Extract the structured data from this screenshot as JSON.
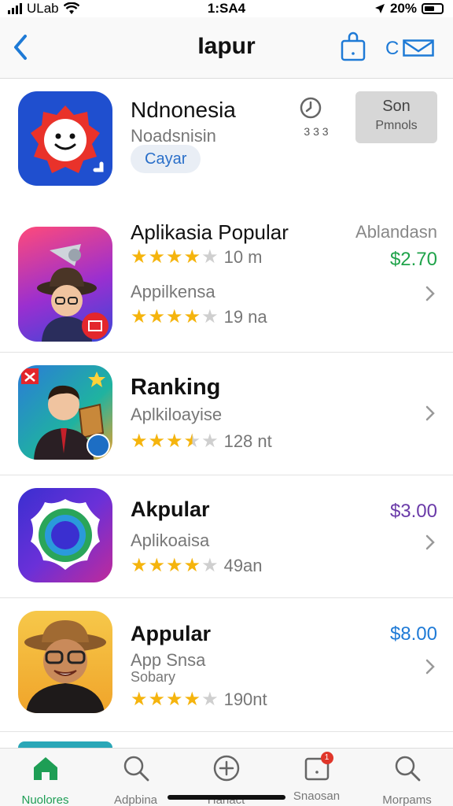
{
  "status_bar": {
    "carrier": "ULab",
    "time": "1:SA4",
    "battery": "20%"
  },
  "nav": {
    "title": "Iapur",
    "cart_label": "C"
  },
  "featured": {
    "title": "Ndnonesia",
    "subtitle": "Noadsnisin",
    "badge": "Cayar",
    "download_count": "3 3 3",
    "button_top": "Son",
    "button_bottom": "Pmnols"
  },
  "apps": [
    {
      "title": "Aplikasia Popular",
      "tag": "Ablandasn",
      "price": "$2.70",
      "price_color": "#1fa34a",
      "rating1": 4,
      "count1": "10 m",
      "subtitle": "Appilkensa",
      "rating2": 4,
      "count2": "19 na"
    },
    {
      "title": "Ranking",
      "subtitle": "Aplkiloayise",
      "rating": 3.5,
      "count": "128 nt"
    },
    {
      "title": "Akpular",
      "subtitle": "Aplikoaisa",
      "price": "$3.00",
      "price_color": "#6a3aa8",
      "rating": 4,
      "count": "49an"
    },
    {
      "title": "Appular",
      "subtitle": "App Snsa",
      "subtitle2": "Sobary",
      "price": "$8.00",
      "price_color": "#1e7ad6",
      "rating": 4,
      "count": "190nt"
    }
  ],
  "tabs": [
    {
      "label": "Nuolores",
      "icon": "home-icon",
      "active": true
    },
    {
      "label": "Adpbina",
      "icon": "search-icon",
      "active": false
    },
    {
      "label": "Hanact",
      "icon": "add-icon",
      "active": false
    },
    {
      "label": "Snaosan",
      "icon": "inbox-icon",
      "active": false,
      "badge": "1"
    },
    {
      "label": "Morpams",
      "icon": "search-icon",
      "active": false
    }
  ],
  "colors": {
    "accent": "#1e7ad6",
    "star": "#f5b40d",
    "star_empty": "#cfcfcf",
    "active_tab": "#1e9e55"
  }
}
